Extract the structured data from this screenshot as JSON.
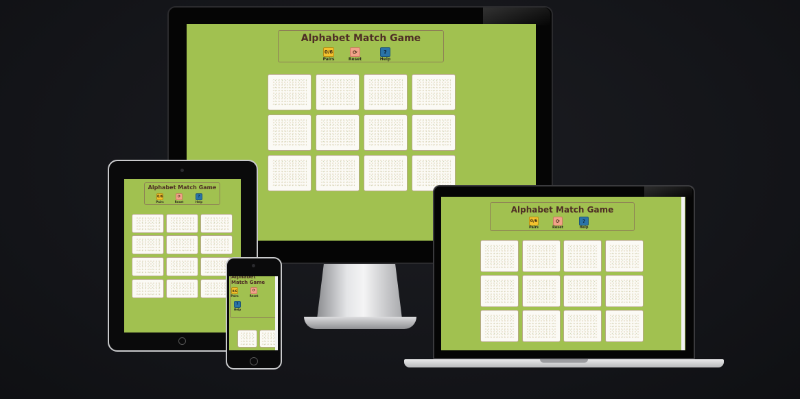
{
  "game": {
    "title": "Alphabet Match Game",
    "pairs_value": "0/6",
    "reset_symbol": "⟳",
    "help_symbol": "?",
    "pairs_label": "Pairs",
    "reset_label": "Reset",
    "help_label": "Help"
  },
  "colors": {
    "background": "#131418",
    "game_background": "#a1c150",
    "title_text": "#4e2d25",
    "pairs_button": "#f2c12e",
    "reset_button": "#f1a289",
    "help_button": "#2a73a6",
    "card_face": "#fbfaf5"
  },
  "devices": [
    "desktop-monitor",
    "tablet",
    "laptop",
    "phone"
  ]
}
